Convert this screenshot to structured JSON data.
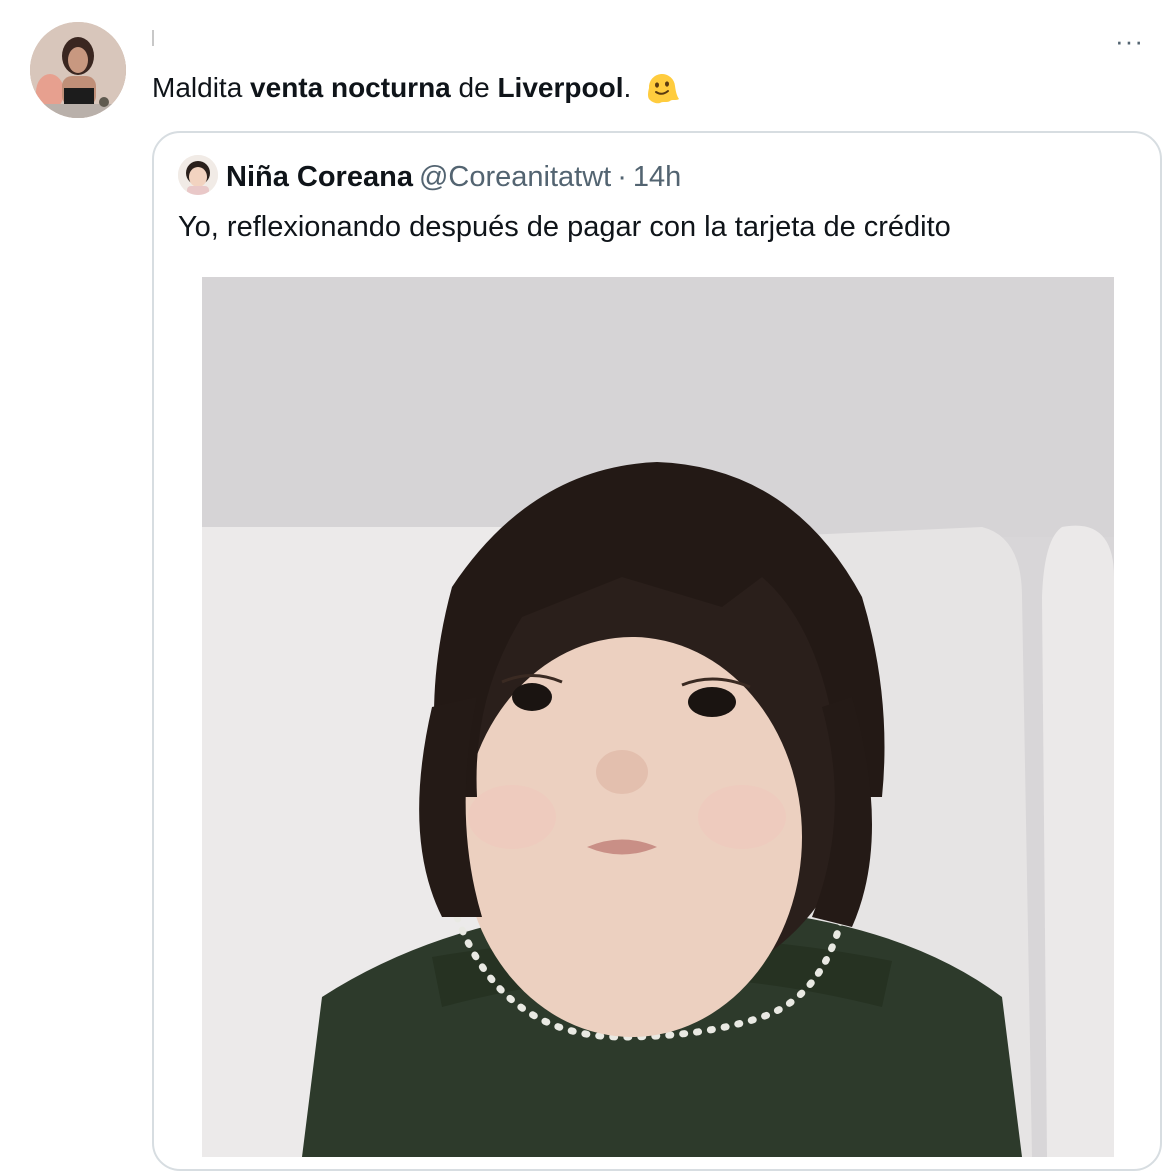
{
  "tweet": {
    "text_parts": [
      {
        "text": "Maldita ",
        "bold": false
      },
      {
        "text": "venta nocturna",
        "bold": true
      },
      {
        "text": " de ",
        "bold": false
      },
      {
        "text": "Liverpool",
        "bold": true
      },
      {
        "text": ".",
        "bold": false
      }
    ],
    "more_label": "···",
    "emoji_icon": "melting-face-icon"
  },
  "quote": {
    "name": "Niña Coreana",
    "handle": "@Coreanitatwt",
    "separator": "·",
    "time": "14h",
    "text": "Yo, reflexionando después de pagar con la tarjeta de crédito"
  },
  "colors": {
    "text": "#0f1419",
    "secondary": "#536471",
    "border": "#d7dde1"
  }
}
